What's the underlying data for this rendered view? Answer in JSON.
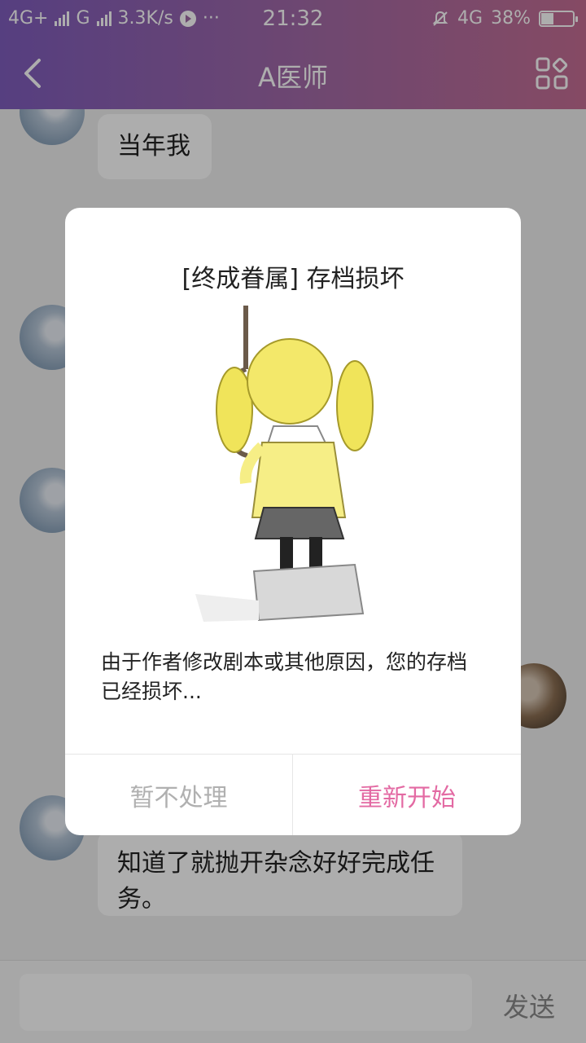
{
  "statusbar": {
    "left_net": "4G+",
    "left_sig2": "G",
    "speed": "3.3K/s",
    "dots": "···",
    "time": "21:32",
    "right_net": "4G",
    "battery": "38%"
  },
  "nav": {
    "title": "A医师"
  },
  "chat": {
    "messages": [
      {
        "text": "当年我"
      },
      {
        "text": "知道了就抛开杂念好好完成任务。"
      }
    ]
  },
  "composer": {
    "send_label": "发送"
  },
  "modal": {
    "title": "[终成眷属] 存档损坏",
    "message": "由于作者修改剧本或其他原因，您的存档已经损坏...",
    "dismiss_label": "暂不处理",
    "restart_label": "重新开始"
  },
  "colors": {
    "header_start": "#7f5dbd",
    "header_end": "#c56e94",
    "restart_accent": "#e36aa3"
  },
  "icons": {
    "back": "chevron-left-icon",
    "menu": "grid-icon",
    "mute": "bell-off-icon",
    "battery": "battery-icon",
    "signal": "signal-icon"
  }
}
